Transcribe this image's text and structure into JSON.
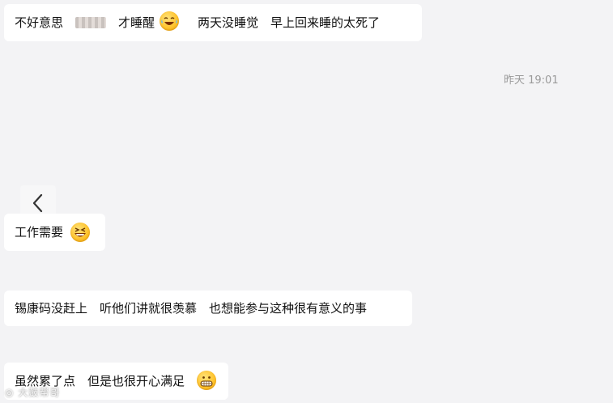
{
  "timestamp": "昨天 19:01",
  "messages": [
    {
      "part1": "不好意思",
      "part2": "才睡醒",
      "part3": "两天没睡觉　早上回来睡的太死了",
      "emoji": "tears-of-joy-emoji"
    },
    {
      "text": "工作需要",
      "emoji": "grinning-squint-emoji"
    },
    {
      "text": "锡康码没赶上　听他们讲就很羡慕　也想能参与这种很有意义的事"
    },
    {
      "text": "虽然累了点　但是也很开心满足",
      "emoji": "grimacing-emoji"
    }
  ],
  "back_icon": "chevron-left-icon",
  "watermark": "大鼓帮哥"
}
